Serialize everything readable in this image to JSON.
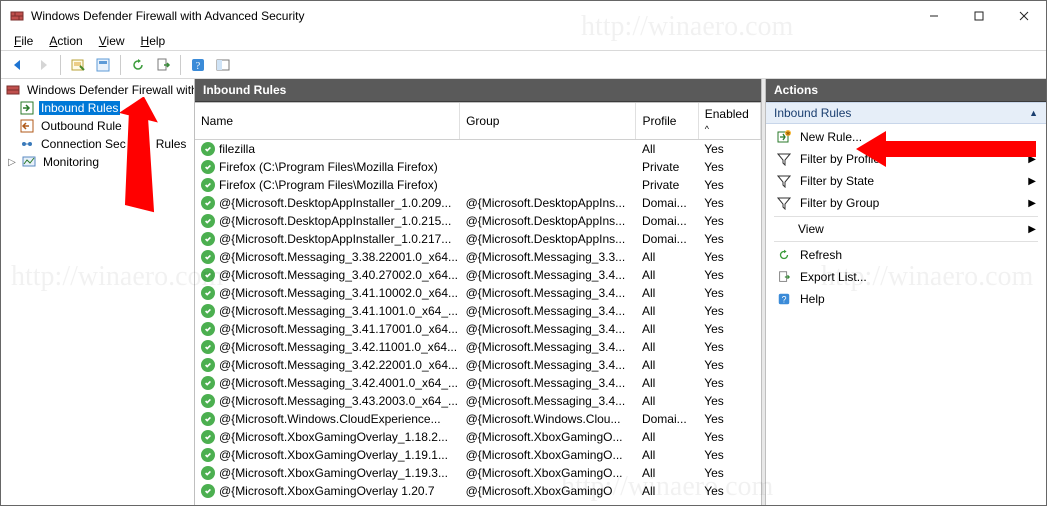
{
  "window": {
    "title": "Windows Defender Firewall with Advanced Security"
  },
  "menu": {
    "file": "File",
    "action": "Action",
    "view": "View",
    "help": "Help"
  },
  "tree": {
    "root": "Windows Defender Firewall with",
    "inbound": "Inbound Rules",
    "outbound": "Outbound Rule",
    "connsec": "Connection Sec",
    "connsec_tail": "Rules",
    "monitoring": "Monitoring"
  },
  "center": {
    "header": "Inbound Rules",
    "columns": {
      "name": "Name",
      "group": "Group",
      "profile": "Profile",
      "enabled": "Enabled"
    },
    "rows": [
      {
        "name": "filezilla",
        "group": "",
        "profile": "All",
        "enabled": "Yes"
      },
      {
        "name": "Firefox (C:\\Program Files\\Mozilla Firefox)",
        "group": "",
        "profile": "Private",
        "enabled": "Yes"
      },
      {
        "name": "Firefox (C:\\Program Files\\Mozilla Firefox)",
        "group": "",
        "profile": "Private",
        "enabled": "Yes"
      },
      {
        "name": "@{Microsoft.DesktopAppInstaller_1.0.209...",
        "group": "@{Microsoft.DesktopAppIns...",
        "profile": "Domai...",
        "enabled": "Yes"
      },
      {
        "name": "@{Microsoft.DesktopAppInstaller_1.0.215...",
        "group": "@{Microsoft.DesktopAppIns...",
        "profile": "Domai...",
        "enabled": "Yes"
      },
      {
        "name": "@{Microsoft.DesktopAppInstaller_1.0.217...",
        "group": "@{Microsoft.DesktopAppIns...",
        "profile": "Domai...",
        "enabled": "Yes"
      },
      {
        "name": "@{Microsoft.Messaging_3.38.22001.0_x64...",
        "group": "@{Microsoft.Messaging_3.3...",
        "profile": "All",
        "enabled": "Yes"
      },
      {
        "name": "@{Microsoft.Messaging_3.40.27002.0_x64...",
        "group": "@{Microsoft.Messaging_3.4...",
        "profile": "All",
        "enabled": "Yes"
      },
      {
        "name": "@{Microsoft.Messaging_3.41.10002.0_x64...",
        "group": "@{Microsoft.Messaging_3.4...",
        "profile": "All",
        "enabled": "Yes"
      },
      {
        "name": "@{Microsoft.Messaging_3.41.1001.0_x64_...",
        "group": "@{Microsoft.Messaging_3.4...",
        "profile": "All",
        "enabled": "Yes"
      },
      {
        "name": "@{Microsoft.Messaging_3.41.17001.0_x64...",
        "group": "@{Microsoft.Messaging_3.4...",
        "profile": "All",
        "enabled": "Yes"
      },
      {
        "name": "@{Microsoft.Messaging_3.42.11001.0_x64...",
        "group": "@{Microsoft.Messaging_3.4...",
        "profile": "All",
        "enabled": "Yes"
      },
      {
        "name": "@{Microsoft.Messaging_3.42.22001.0_x64...",
        "group": "@{Microsoft.Messaging_3.4...",
        "profile": "All",
        "enabled": "Yes"
      },
      {
        "name": "@{Microsoft.Messaging_3.42.4001.0_x64_...",
        "group": "@{Microsoft.Messaging_3.4...",
        "profile": "All",
        "enabled": "Yes"
      },
      {
        "name": "@{Microsoft.Messaging_3.43.2003.0_x64_...",
        "group": "@{Microsoft.Messaging_3.4...",
        "profile": "All",
        "enabled": "Yes"
      },
      {
        "name": "@{Microsoft.Windows.CloudExperience...",
        "group": "@{Microsoft.Windows.Clou...",
        "profile": "Domai...",
        "enabled": "Yes"
      },
      {
        "name": "@{Microsoft.XboxGamingOverlay_1.18.2...",
        "group": "@{Microsoft.XboxGamingO...",
        "profile": "All",
        "enabled": "Yes"
      },
      {
        "name": "@{Microsoft.XboxGamingOverlay_1.19.1...",
        "group": "@{Microsoft.XboxGamingO...",
        "profile": "All",
        "enabled": "Yes"
      },
      {
        "name": "@{Microsoft.XboxGamingOverlay_1.19.3...",
        "group": "@{Microsoft.XboxGamingO...",
        "profile": "All",
        "enabled": "Yes"
      },
      {
        "name": "@{Microsoft.XboxGamingOverlay 1.20.7",
        "group": "@{Microsoft.XboxGamingO",
        "profile": "All",
        "enabled": "Yes"
      }
    ]
  },
  "actions": {
    "header": "Actions",
    "section": "Inbound Rules",
    "new_rule": "New Rule...",
    "filter_profile": "Filter by Profile",
    "filter_state": "Filter by State",
    "filter_group": "Filter by Group",
    "view": "View",
    "refresh": "Refresh",
    "export": "Export List...",
    "help": "Help"
  }
}
